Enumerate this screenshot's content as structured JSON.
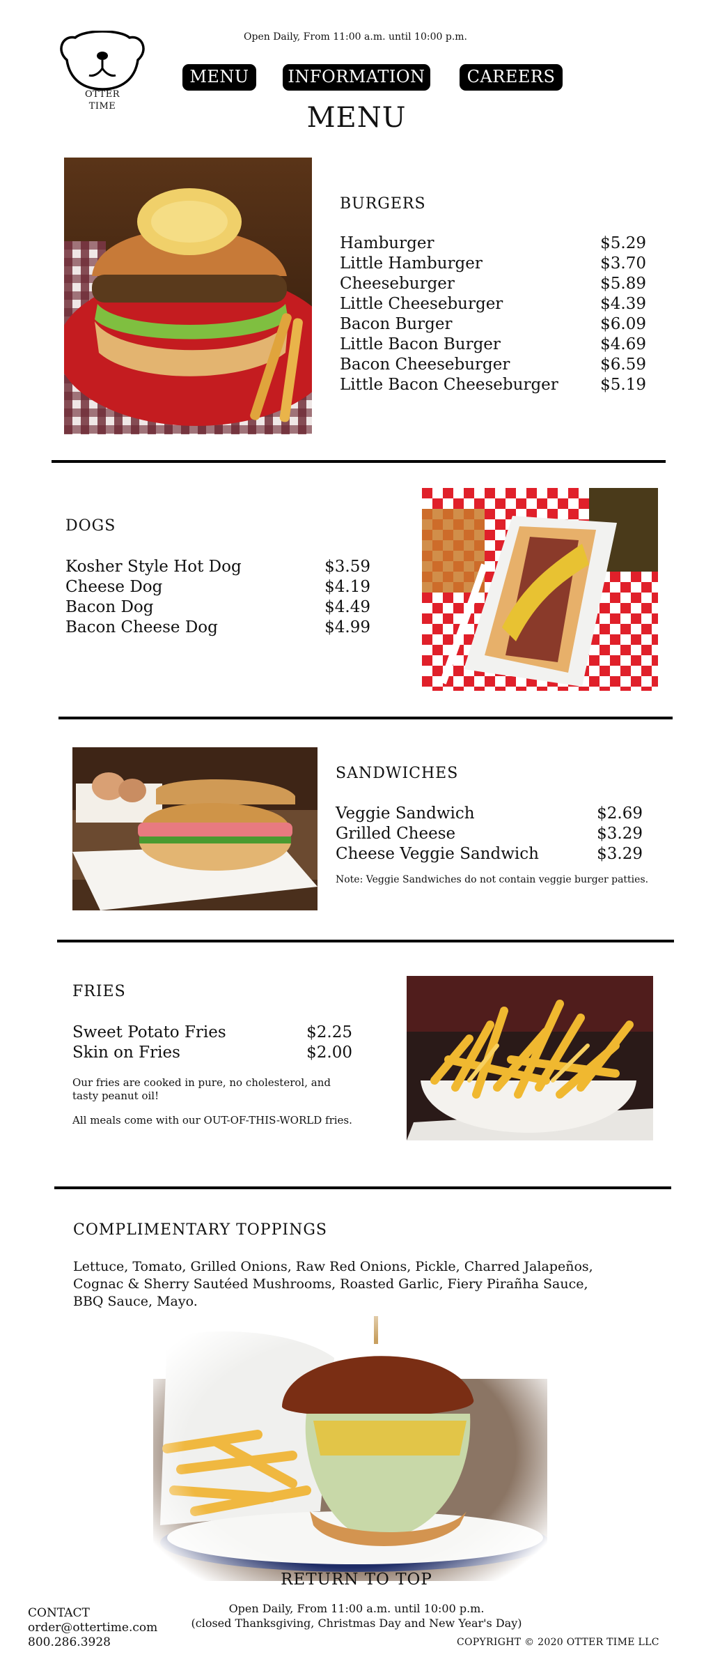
{
  "header": {
    "logo_text_line1": "OTTER",
    "logo_text_line2": "TIME",
    "hours": "Open Daily, From 11:00 a.m. until 10:00 p.m.",
    "nav": {
      "menu": "MENU",
      "information": "INFORMATION",
      "careers": "CAREERS"
    }
  },
  "page_title": "MENU",
  "burgers": {
    "title": "BURGERS",
    "items": [
      {
        "name": "Hamburger",
        "price": "$5.29"
      },
      {
        "name": "Little Hamburger",
        "price": "$3.70"
      },
      {
        "name": "Cheeseburger",
        "price": "$5.89"
      },
      {
        "name": "Little Cheeseburger",
        "price": "$4.39"
      },
      {
        "name": "Bacon Burger",
        "price": "$6.09"
      },
      {
        "name": "Little Bacon Burger",
        "price": "$4.69"
      },
      {
        "name": "Bacon Cheeseburger",
        "price": "$6.59"
      },
      {
        "name": "Little Bacon Cheeseburger",
        "price": "$5.19"
      }
    ]
  },
  "dogs": {
    "title": "DOGS",
    "items": [
      {
        "name": "Kosher Style Hot Dog",
        "price": "$3.59"
      },
      {
        "name": "Cheese Dog",
        "price": "$4.19"
      },
      {
        "name": "Bacon Dog",
        "price": "$4.49"
      },
      {
        "name": "Bacon Cheese Dog",
        "price": "$4.99"
      }
    ]
  },
  "sandwiches": {
    "title": "SANDWICHES",
    "items": [
      {
        "name": "Veggie Sandwich",
        "price": "$2.69"
      },
      {
        "name": "Grilled Cheese",
        "price": "$3.29"
      },
      {
        "name": "Cheese Veggie Sandwich",
        "price": "$3.29"
      }
    ],
    "note": "Note: Veggie Sandwiches do not contain veggie burger patties."
  },
  "fries": {
    "title": "FRIES",
    "items": [
      {
        "name": "Sweet Potato Fries",
        "price": "$2.25"
      },
      {
        "name": "Skin on Fries",
        "price": "$2.00"
      }
    ],
    "note1_line1": "Our fries are cooked in pure, no cholesterol, and",
    "note1_line2": "tasty peanut oil!",
    "note2": "All meals come with our OUT-OF-THIS-WORLD fries."
  },
  "toppings": {
    "title": "COMPLIMENTARY TOPPINGS",
    "line1": "Lettuce, Tomato, Grilled Onions, Raw Red Onions, Pickle, Charred Jalapeños,",
    "line2": "Cognac & Sherry Sautéed Mushrooms, Roasted Garlic, Fiery Pirañha Sauce,",
    "line3": "BBQ Sauce, Mayo."
  },
  "footer": {
    "return_to_top": "RETURN TO TOP",
    "hours_line1": "Open Daily, From 11:00 a.m. until 10:00 p.m.",
    "hours_line2": "(closed Thanksgiving, Christmas Day and New Year's Day)",
    "contact_label": "CONTACT",
    "email": "order@ottertime.com",
    "phone": "800.286.3928",
    "copyright": "COPYRIGHT © 2020 OTTER TIME LLC"
  },
  "colors": {
    "nav_bg": "#000000",
    "nav_text": "#ffffff",
    "rule": "#000000"
  }
}
